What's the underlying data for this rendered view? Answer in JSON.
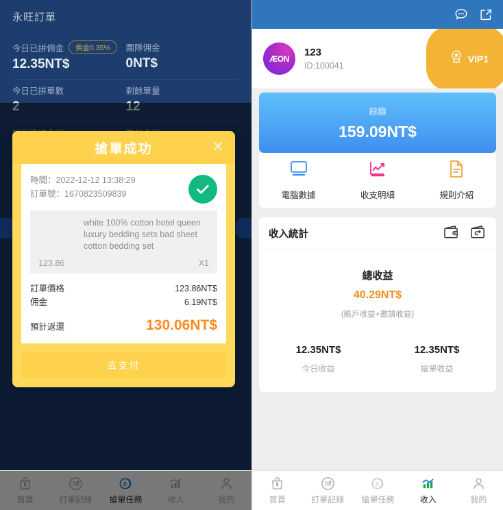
{
  "left": {
    "header": {
      "app_title": "永旺訂單",
      "stats": [
        {
          "label": "今日已拼佣金",
          "badge": "佣金0.35%",
          "value": "12.35NT$"
        },
        {
          "label": "團隊佣金",
          "badge": "",
          "value": "0NT$"
        },
        {
          "label": "今日已拼單數",
          "badge": "",
          "value": "2"
        },
        {
          "label": "剩餘單量",
          "badge": "",
          "value": "12"
        },
        {
          "label": "賬戶凍結金額",
          "badge": "",
          "value": ""
        },
        {
          "label": "當前金額",
          "badge": "",
          "value": ""
        }
      ]
    },
    "modal": {
      "title": "搶單成功",
      "close_icon": "close-icon",
      "time_label": "時間：",
      "time_value": "2022-12-12 13:38:29",
      "order_label": "訂單號：",
      "order_value": "1670823509839",
      "status_icon": "check-circle-icon",
      "product_desc": "white 100% cotton hotel queen luxury bedding sets bad sheet cotton bedding set",
      "product_price": "123.86",
      "product_qty": "X1",
      "rows": [
        {
          "label": "訂單價格",
          "value": "123.86NT$"
        },
        {
          "label": "佣金",
          "value": "6.19NT$"
        }
      ],
      "total_label": "預計返還",
      "total_value": "130.06NT$",
      "cta_label": "去支付"
    },
    "tabbar": {
      "active_index": 2,
      "items": [
        {
          "label": "首頁",
          "icon": "bag-icon"
        },
        {
          "label": "訂單記錄",
          "icon": "order-record-icon"
        },
        {
          "label": "搶單任務",
          "icon": "coin-task-icon"
        },
        {
          "label": "收入",
          "icon": "bar-chart-icon"
        },
        {
          "label": "我的",
          "icon": "user-icon"
        }
      ]
    }
  },
  "right": {
    "topbar": {
      "message_icon": "chat-bubble-icon",
      "share_icon": "external-link-icon"
    },
    "profile": {
      "avatar_text": "ÆON",
      "name": "123",
      "id": "ID:100041",
      "vip_label": "VIP1",
      "vip_icon": "medal-star-icon"
    },
    "balance": {
      "label": "餘額",
      "value": "159.09NT$"
    },
    "quick_actions": [
      {
        "label": "電腦數據",
        "icon": "monitor-icon",
        "color": "#3d8ef0"
      },
      {
        "label": "收支明細",
        "icon": "trend-chart-icon",
        "color": "#f0308f"
      },
      {
        "label": "規則介紹",
        "icon": "document-icon",
        "color": "#f2a33c"
      }
    ],
    "stats": {
      "title": "收入統計",
      "head_icons": [
        "wallet-deposit-icon",
        "wallet-withdraw-icon"
      ],
      "total_title": "總收益",
      "total_amount": "40.29NT$",
      "total_note": "(賬戶收益+邀請收益)",
      "splits": [
        {
          "amount": "12.35NT$",
          "label": "今日收益"
        },
        {
          "amount": "12.35NT$",
          "label": "搶單收益"
        }
      ]
    },
    "tabbar": {
      "active_index": 3,
      "items": [
        {
          "label": "首頁",
          "icon": "bag-icon"
        },
        {
          "label": "訂單記錄",
          "icon": "order-record-icon"
        },
        {
          "label": "搶單任務",
          "icon": "coin-task-icon"
        },
        {
          "label": "收入",
          "icon": "bar-chart-icon"
        },
        {
          "label": "我的",
          "icon": "user-icon"
        }
      ]
    }
  },
  "colors": {
    "left_bg": "#1d3d6e",
    "modal_yellow": "#ffd24d",
    "orange_accent": "#ff8a1e",
    "green_check": "#12b981",
    "blue_header": "#2f76bd",
    "vip_yellow": "#f4b335"
  }
}
